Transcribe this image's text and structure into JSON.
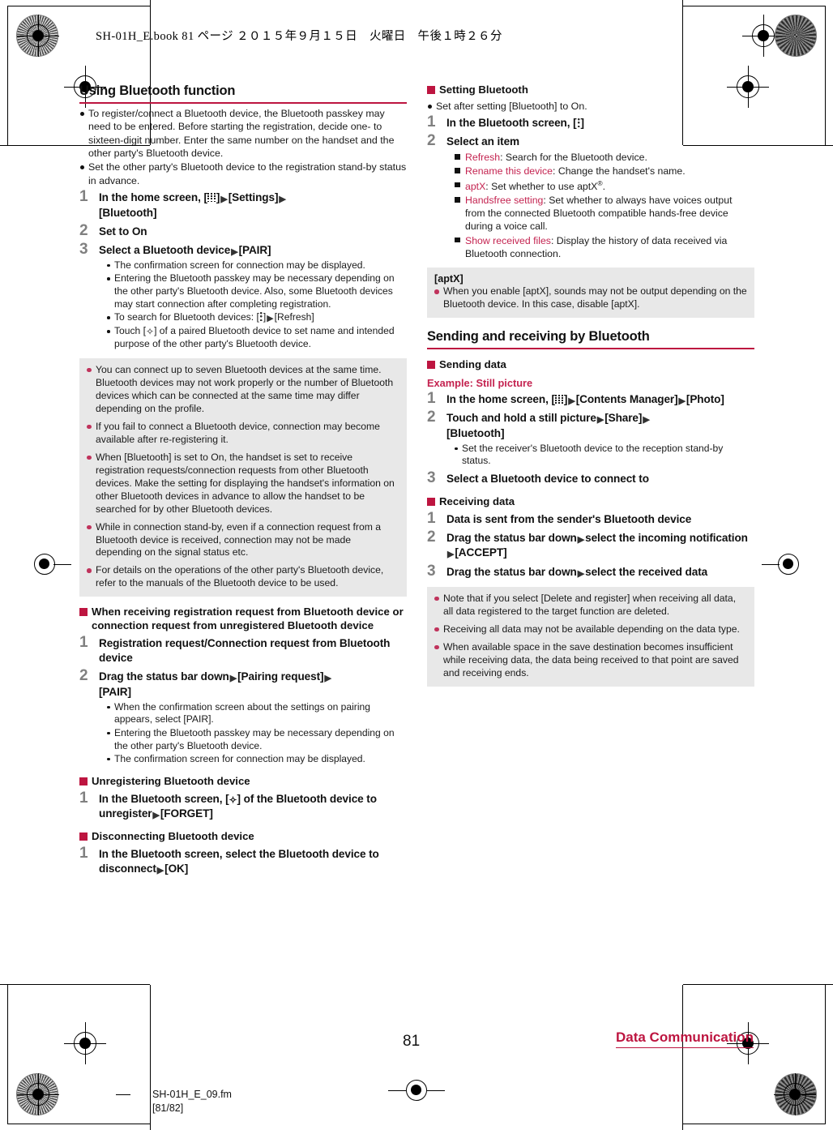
{
  "header": {
    "book_line": "SH-01H_E.book   81 ページ   ２０１５年９月１５日　火曜日　午後１時２６分"
  },
  "footer": {
    "page_number": "81",
    "chapter": "Data Communication",
    "file_name": "SH-01H_E_09.fm",
    "file_pages": "[81/82]"
  },
  "colors": {
    "accent": "#bd1540",
    "item_red": "#c42350",
    "note_bullet": "#c0335c",
    "note_bg": "#e8e8e8",
    "step_number": "#808080"
  },
  "left_column": {
    "section_title": "Using Bluetooth function",
    "intro_bullets": [
      "To register/connect a Bluetooth device, the Bluetooth passkey may need to be entered. Before starting the registration, decide one- to sixteen-digit number. Enter the same number on the handset and the other party's Bluetooth device.",
      "Set the other party's Bluetooth device to the registration stand-by status in advance."
    ],
    "steps": [
      {
        "num": "1",
        "text_before_icon": "In the home screen, [",
        "icon": "apps-grid-icon",
        "text_after_icon": "]",
        "tail": "[Settings]",
        "tail2": "[Bluetooth]"
      },
      {
        "num": "2",
        "text": "Set to On"
      },
      {
        "num": "3",
        "text": "Select a Bluetooth device",
        "tail": "[PAIR]"
      }
    ],
    "step3_bullets": [
      "The confirmation screen for connection may be displayed.",
      "Entering the Bluetooth passkey may be necessary depending on the other party's Bluetooth device. Also, some Bluetooth devices may start connection after completing registration.",
      "To search for Bluetooth devices: [menu-dots-icon] [Refresh]",
      "Touch [gear-icon] of a paired Bluetooth device to set name and intended purpose of the other party's Bluetooth device."
    ],
    "step3_bullet3_pre": "To search for Bluetooth devices: [",
    "step3_bullet3_mid": "]",
    "step3_bullet3_post": "[Refresh]",
    "step3_bullet4_pre": "Touch [",
    "step3_bullet4_post": "] of a paired Bluetooth device to set name and intended purpose of the other party's Bluetooth device.",
    "notes": [
      "You can connect up to seven Bluetooth devices at the same time. Bluetooth devices may not work properly or the number of Bluetooth devices which can be connected at the same time may differ depending on the profile.",
      "If you fail to connect a Bluetooth device, connection may become available after re-registering it.",
      "When [Bluetooth] is set to On, the handset is set to receive registration requests/connection requests from other Bluetooth devices. Make the setting for displaying the handset's information on other Bluetooth devices in advance to allow the handset to be searched for by other Bluetooth devices.",
      "While in connection stand-by, even if a connection request from a Bluetooth device is received, connection may not be made depending on the signal status etc.",
      "For details on the operations of the other party's Bluetooth device, refer to the manuals of the Bluetooth device to be used."
    ],
    "sub_receiving_request": {
      "title": "When receiving registration request from Bluetooth device or connection request from unregistered Bluetooth device",
      "steps": [
        {
          "num": "1",
          "text": "Registration request/Connection request from Bluetooth device"
        },
        {
          "num": "2",
          "text": "Drag the status bar down",
          "tail": "[Pairing request]",
          "tail2": "[PAIR]"
        }
      ],
      "bullets": [
        "When the confirmation screen about the settings on pairing appears, select [PAIR].",
        "Entering the Bluetooth passkey may be necessary depending on the other party's Bluetooth device.",
        "The confirmation screen for connection may be displayed."
      ]
    },
    "sub_unregistering": {
      "title": "Unregistering Bluetooth device",
      "step_num": "1",
      "text_pre": "In the Bluetooth screen, [",
      "text_post": "] of the Bluetooth device to unregister",
      "tail": "[FORGET]"
    },
    "sub_disconnecting": {
      "title": "Disconnecting Bluetooth device",
      "step_num": "1",
      "text": "In the Bluetooth screen, select the Bluetooth device to disconnect",
      "tail": "[OK]"
    }
  },
  "right_column": {
    "sub_setting": {
      "title": "Setting Bluetooth",
      "intro_bullet": "Set after setting [Bluetooth] to On.",
      "step1_num": "1",
      "step1_pre": "In the Bluetooth screen, [",
      "step1_post": "]",
      "step2_num": "2",
      "step2_text": "Select an item",
      "items": [
        {
          "name": "Refresh",
          "desc": ": Search for the Bluetooth device."
        },
        {
          "name": "Rename this device",
          "desc": ": Change the handset's name."
        },
        {
          "name": "aptX",
          "desc": ": Set whether to use aptX",
          "sup": "®",
          "desc_tail": "."
        },
        {
          "name": "Handsfree setting",
          "desc": ": Set whether to always have voices output from the connected Bluetooth compatible hands-free device during a voice call."
        },
        {
          "name": "Show received files",
          "desc": ": Display the history of data received via Bluetooth connection."
        }
      ]
    },
    "aptx_note": {
      "title": "[aptX]",
      "text": "When you enable [aptX], sounds may not be output depending on the Bluetooth device. In this case, disable [aptX]."
    },
    "section_title": "Sending and receiving by Bluetooth",
    "sub_sending": {
      "title": "Sending data",
      "example": "Example: Still picture",
      "steps": [
        {
          "num": "1",
          "pre": "In the home screen, [",
          "post": "]",
          "tail": "[Contents Manager]",
          "tail2": "[Photo]"
        },
        {
          "num": "2",
          "text": "Touch and hold a still picture",
          "tail": "[Share]",
          "tail2": "[Bluetooth]"
        },
        {
          "num": "3",
          "text": "Select a Bluetooth device to connect to"
        }
      ],
      "step2_bullet": "Set the receiver's Bluetooth device to the reception stand-by status."
    },
    "sub_receiving": {
      "title": "Receiving data",
      "steps": [
        {
          "num": "1",
          "text": "Data is sent from the sender's Bluetooth device"
        },
        {
          "num": "2",
          "text": "Drag the status bar down",
          "tail": "select the incoming notification",
          "tail2": "[ACCEPT]"
        },
        {
          "num": "3",
          "text": "Drag the status bar down",
          "tail": "select the received data"
        }
      ]
    },
    "notes": [
      "Note that if you select [Delete and register] when receiving all data, all data registered to the target function are deleted.",
      "Receiving all data may not be available depending on the data type.",
      "When available space in the save destination becomes insufficient while receiving data, the data being received to that point are saved and receiving ends."
    ]
  }
}
